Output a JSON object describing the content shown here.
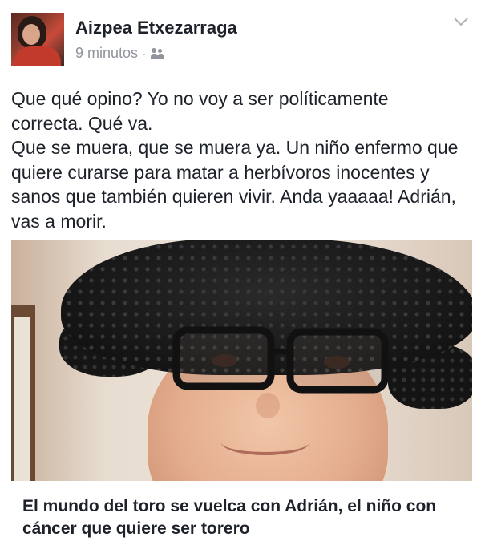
{
  "post": {
    "author": "Aizpea Etxezarraga",
    "time": "9 minutos",
    "separator": "·",
    "audience_icon": "friends-icon",
    "menu_icon": "chevron-down-icon",
    "text": "Que qué opino? Yo no voy a ser políticamente\ncorrecta. Qué va.\nQue se muera, que se muera ya. Un niño enfermo que\nquiere curarse para matar a herbívoros inocentes y\nsanos que también quieren vivir. Anda yaaaaa! Adrián,\nvas a morir."
  },
  "link": {
    "title": "El mundo del toro se vuelca con Adrián, el niño con cáncer que quiere ser torero"
  }
}
